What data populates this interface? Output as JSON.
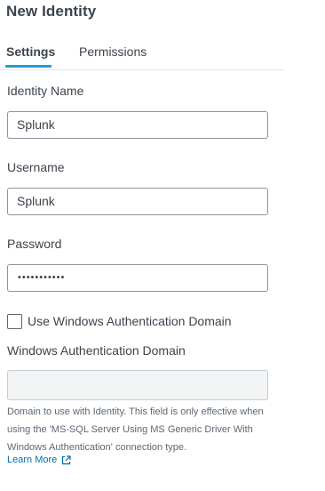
{
  "title": "New Identity",
  "tabs": [
    {
      "label": "Settings",
      "active": true
    },
    {
      "label": "Permissions",
      "active": false
    }
  ],
  "fields": {
    "identity_name": {
      "label": "Identity Name",
      "value": "Splunk"
    },
    "username": {
      "label": "Username",
      "value": "Splunk"
    },
    "password": {
      "label": "Password",
      "value": "•••••••••••"
    },
    "windows_auth_checkbox": {
      "label": "Use Windows Authentication Domain",
      "checked": false
    },
    "windows_domain": {
      "label": "Windows Authentication Domain",
      "value": "",
      "disabled": true
    }
  },
  "help_text": "Domain to use with Identity. This field is only effective when using the 'MS-SQL Server Using MS Generic Driver With Windows Authentication' connection type.",
  "learn_more": {
    "label": "Learn More",
    "icon": "external-link-icon"
  },
  "colors": {
    "accent": "#1a9ed4",
    "link": "#006eaa",
    "text": "#3c444d"
  }
}
